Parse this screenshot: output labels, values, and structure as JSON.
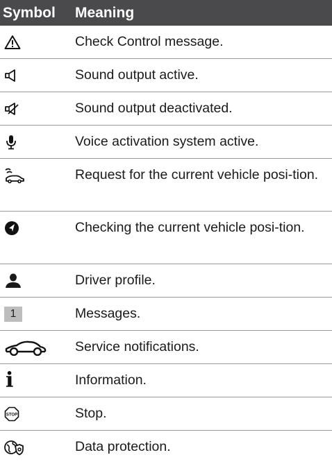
{
  "header": {
    "symbol": "Symbol",
    "meaning": "Meaning"
  },
  "rows": [
    {
      "icon": "warning-triangle-icon",
      "meaning": "Check Control message."
    },
    {
      "icon": "speaker-icon",
      "meaning": "Sound output active."
    },
    {
      "icon": "speaker-muted-icon",
      "meaning": "Sound output deactivated."
    },
    {
      "icon": "microphone-icon",
      "meaning": "Voice activation system active."
    },
    {
      "icon": "vehicle-position-request-icon",
      "meaning": "Request for the current vehicle posi-tion."
    },
    {
      "icon": "navigation-arrow-icon",
      "meaning": "Checking the current vehicle posi-tion."
    },
    {
      "icon": "driver-profile-icon",
      "meaning": "Driver profile."
    },
    {
      "icon": "message-count-badge",
      "badge": "1",
      "meaning": "Messages."
    },
    {
      "icon": "car-outline-icon",
      "meaning": "Service notifications."
    },
    {
      "icon": "info-icon",
      "glyph": "i",
      "meaning": "Information."
    },
    {
      "icon": "stop-sign-icon",
      "sign_text": "STOP",
      "meaning": "Stop."
    },
    {
      "icon": "data-protection-icon",
      "meaning": "Data protection."
    }
  ]
}
